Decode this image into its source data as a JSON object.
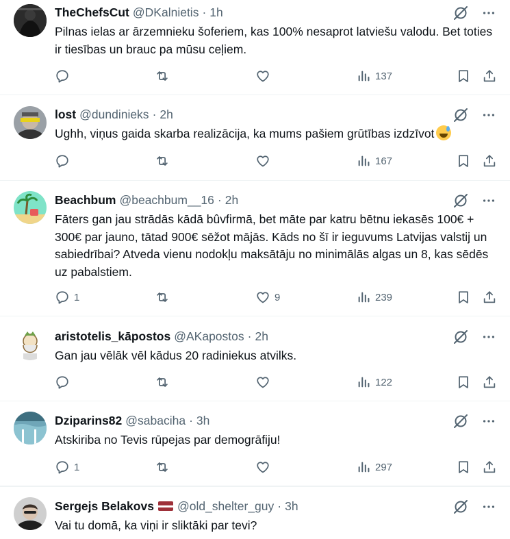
{
  "tweets": [
    {
      "name": "TheChefsCut",
      "handle": "@DKalnietis",
      "time": "1h",
      "text": "Pilnas ielas ar ārzemnieku šoferiem, kas 100% nesaprot latviešu valodu. Bet toties ir tiesības un brauc pa mūsu ceļiem.",
      "replies": "",
      "likes": "",
      "views": "137"
    },
    {
      "name": "lost",
      "handle": "@dundinieks",
      "time": "2h",
      "text": "Ughh, viņus gaida skarba realizācija, ka mums pašiem grūtības izdzīvot",
      "emoji": "grinning-sweat-emoji",
      "replies": "",
      "likes": "",
      "views": "167"
    },
    {
      "name": "Beachbum",
      "handle": "@beachbum__16",
      "time": "2h",
      "text": "Fāters gan jau strādās kādā bûvfirmā, bet māte par katru bētnu iekasēs 100€ + 300€ par jauno, tātad 900€ sēžot mājās. Kāds no šī ir ieguvums Latvijas valstij un sabiedrībai? Atveda vienu nodokļu maksātāju no minimālās algas un 8, kas sēdēs uz pabalstiem.",
      "replies": "1",
      "likes": "9",
      "views": "239"
    },
    {
      "name": "aristotelis_kāpostos",
      "handle": "@AKapostos",
      "time": "2h",
      "text": "Gan jau vēlāk vēl kādus 20 radiniekus atvilks.",
      "replies": "",
      "likes": "",
      "views": "122"
    },
    {
      "name": "Dziparins82",
      "handle": "@sabaciha",
      "time": "3h",
      "text": "Atskiriba no Tevis rūpejas par demogrāfiju!",
      "replies": "1",
      "likes": "",
      "views": "297"
    },
    {
      "name": "Sergejs Belakovs",
      "handle": "@old_shelter_guy",
      "time": "3h",
      "flag": "latvia-flag",
      "text": "Vai tu domā, ka viņi ir sliktāki par tevi?",
      "replies": "",
      "likes": "",
      "views": ""
    }
  ],
  "colors": {
    "muted": "#536471",
    "text": "#0f1419",
    "divider": "#eff3f4",
    "latvia_red": "#9e3039"
  },
  "icons": [
    "reply-icon",
    "retweet-icon",
    "like-icon",
    "views-icon",
    "bookmark-icon",
    "share-icon",
    "grok-icon",
    "more-icon"
  ]
}
